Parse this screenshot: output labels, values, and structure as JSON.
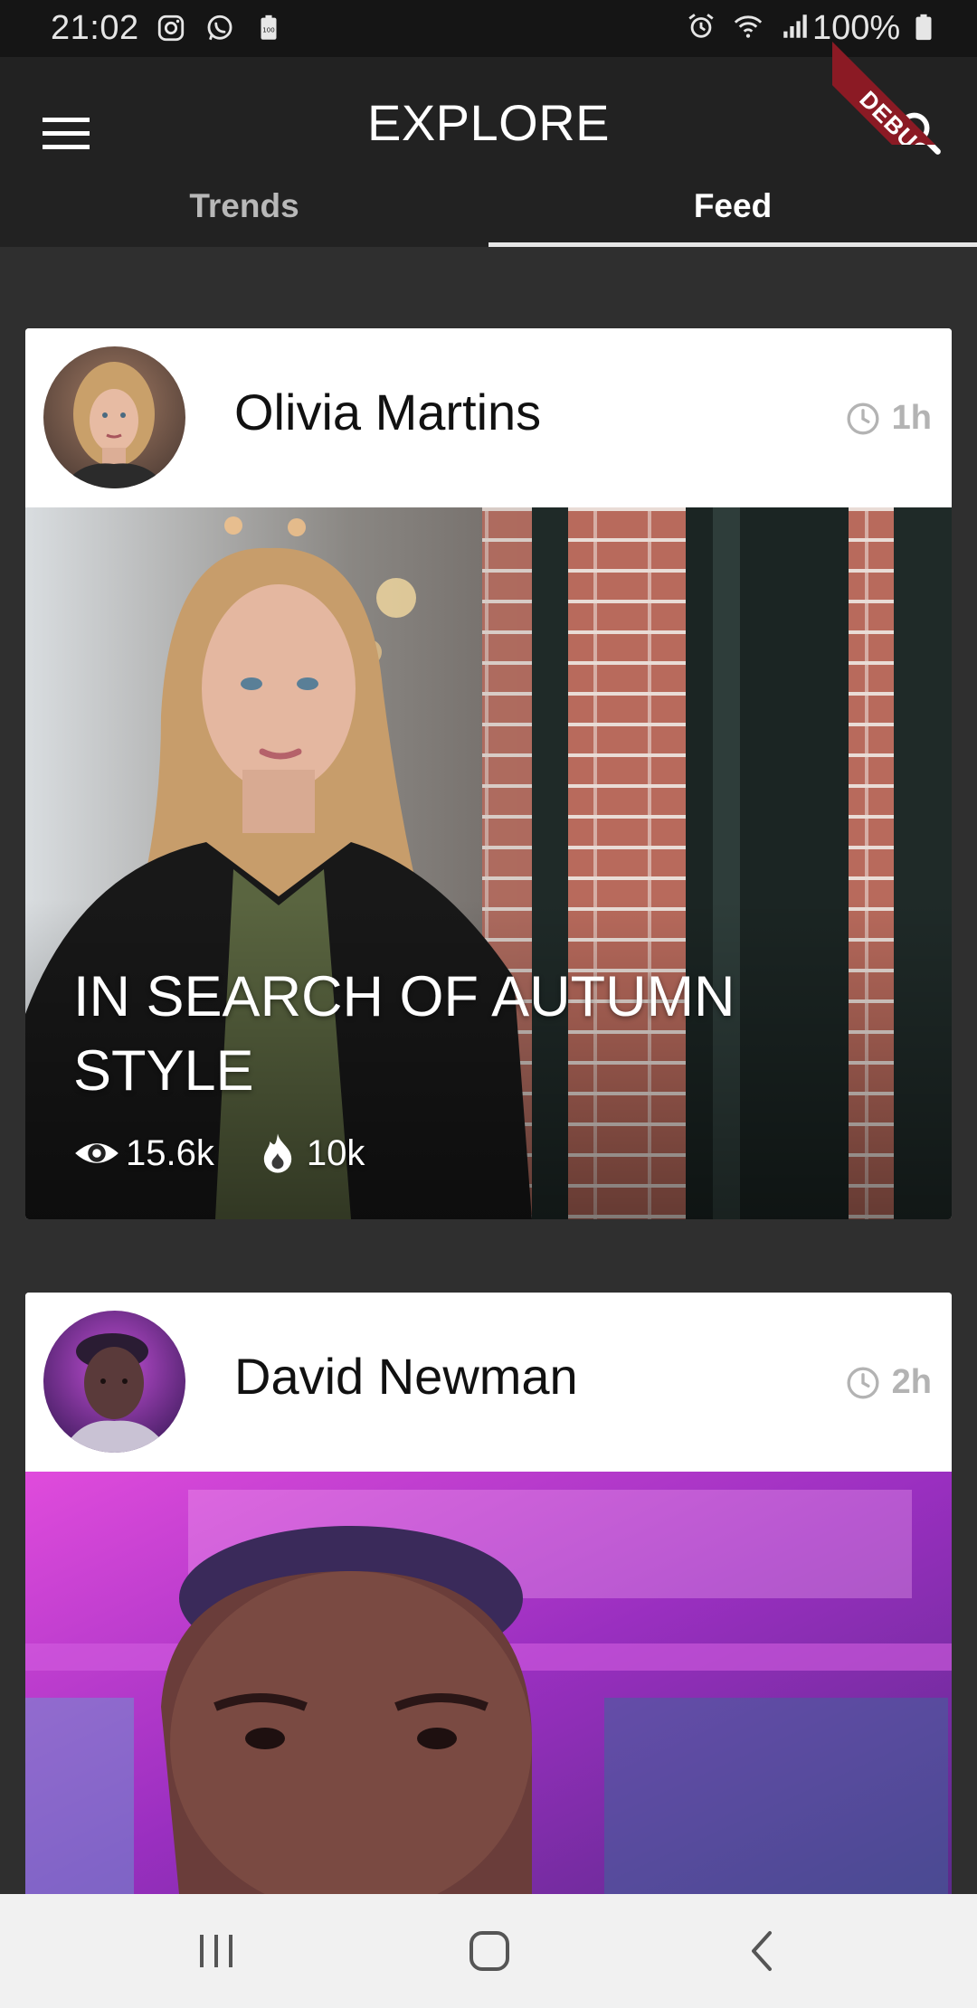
{
  "status_bar": {
    "time": "21:02",
    "battery_percent": "100%",
    "left_icons": [
      "instagram-icon",
      "whatsapp-icon",
      "battery-saver-icon"
    ],
    "right_icons": [
      "alarm-icon",
      "wifi-icon",
      "signal-icon",
      "battery-icon"
    ]
  },
  "app_bar": {
    "title": "EXPLORE",
    "menu_icon": "hamburger-menu-icon",
    "search_icon": "search-icon",
    "debug_banner": "DEBUG"
  },
  "tabs": [
    {
      "label": "Trends",
      "active": false
    },
    {
      "label": "Feed",
      "active": true
    }
  ],
  "feed": [
    {
      "author": "Olivia Martins",
      "time_ago": "1h",
      "headline": "IN SEARCH OF AUTUMN STYLE",
      "views": "15.6k",
      "likes": "10k"
    },
    {
      "author": "David Newman",
      "time_ago": "2h"
    }
  ],
  "nav_bar": {
    "buttons": [
      "recent-apps-icon",
      "home-icon",
      "back-icon"
    ]
  },
  "colors": {
    "status_bar_bg": "#151515",
    "app_bar_bg": "#222222",
    "page_bg": "#2f2f2f",
    "debug_ribbon": "#8b1a24",
    "nav_bar_bg": "#f1f1f1"
  }
}
